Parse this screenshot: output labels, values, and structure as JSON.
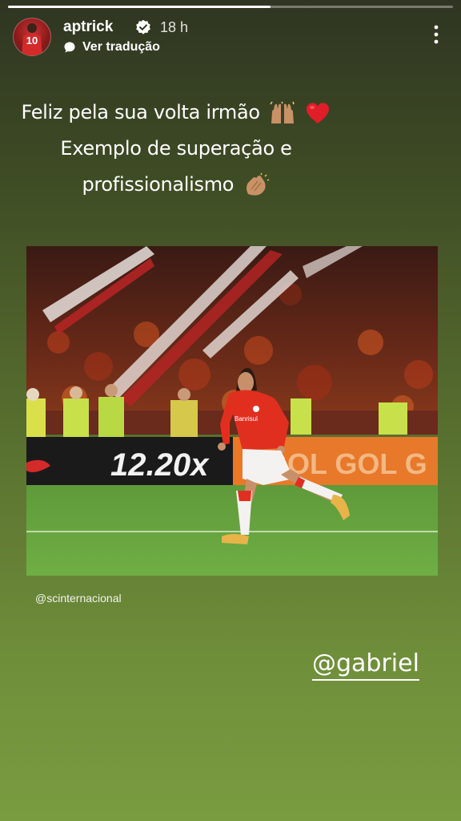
{
  "story": {
    "progress": 0.59
  },
  "header": {
    "username": "aptrick",
    "time": "18 h",
    "translate_label": "Ver tradução",
    "avatar_number": "10"
  },
  "caption": {
    "line1": "Feliz pela sua volta irmão",
    "line2": "Exemplo de superação e",
    "line3": "profissionalismo"
  },
  "photo": {
    "board_text": "12.20x",
    "board_brand": "GOL GOL G",
    "shirt_sponsor": "Banrisul"
  },
  "credit": "@scinternacional",
  "mention": "@gabriel",
  "icons": {
    "verified": "verified-badge-icon",
    "translate": "translate-bubble-icon",
    "more": "more-vertical-icon",
    "emoji1": "raised-hands-emoji",
    "emoji2": "red-heart-emoji",
    "emoji3": "clapping-hands-emoji"
  }
}
